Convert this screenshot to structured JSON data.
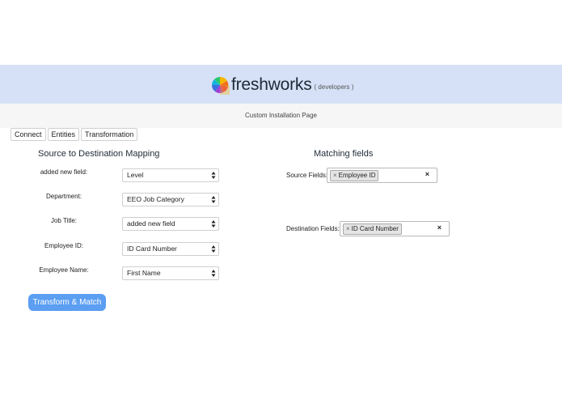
{
  "header": {
    "brand": "freshworks",
    "brand_sub": "( developers )",
    "subtitle": "Custom Installation Page"
  },
  "tabs": [
    "Connect",
    "Entities",
    "Transformation"
  ],
  "mapping": {
    "title": "Source to Destination Mapping",
    "rows": [
      {
        "label": "added new field:",
        "value": "Level"
      },
      {
        "label": "Department:",
        "value": "EEO Job Category"
      },
      {
        "label": "Job Title:",
        "value": "added new field"
      },
      {
        "label": "Employee ID:",
        "value": "ID Card Number"
      },
      {
        "label": "Employee Name:",
        "value": "First Name"
      }
    ],
    "button": "Transform & Match"
  },
  "matching": {
    "title": "Matching fields",
    "source_label": "Source Fields:",
    "source_chip": "Employee ID",
    "dest_label": "Destination Fields:",
    "dest_chip": "ID Card Number",
    "chip_remove": "×",
    "clear": "×"
  },
  "colors": {
    "header_bg": "#d6e1f7",
    "button_bg": "#5b9ef2"
  }
}
